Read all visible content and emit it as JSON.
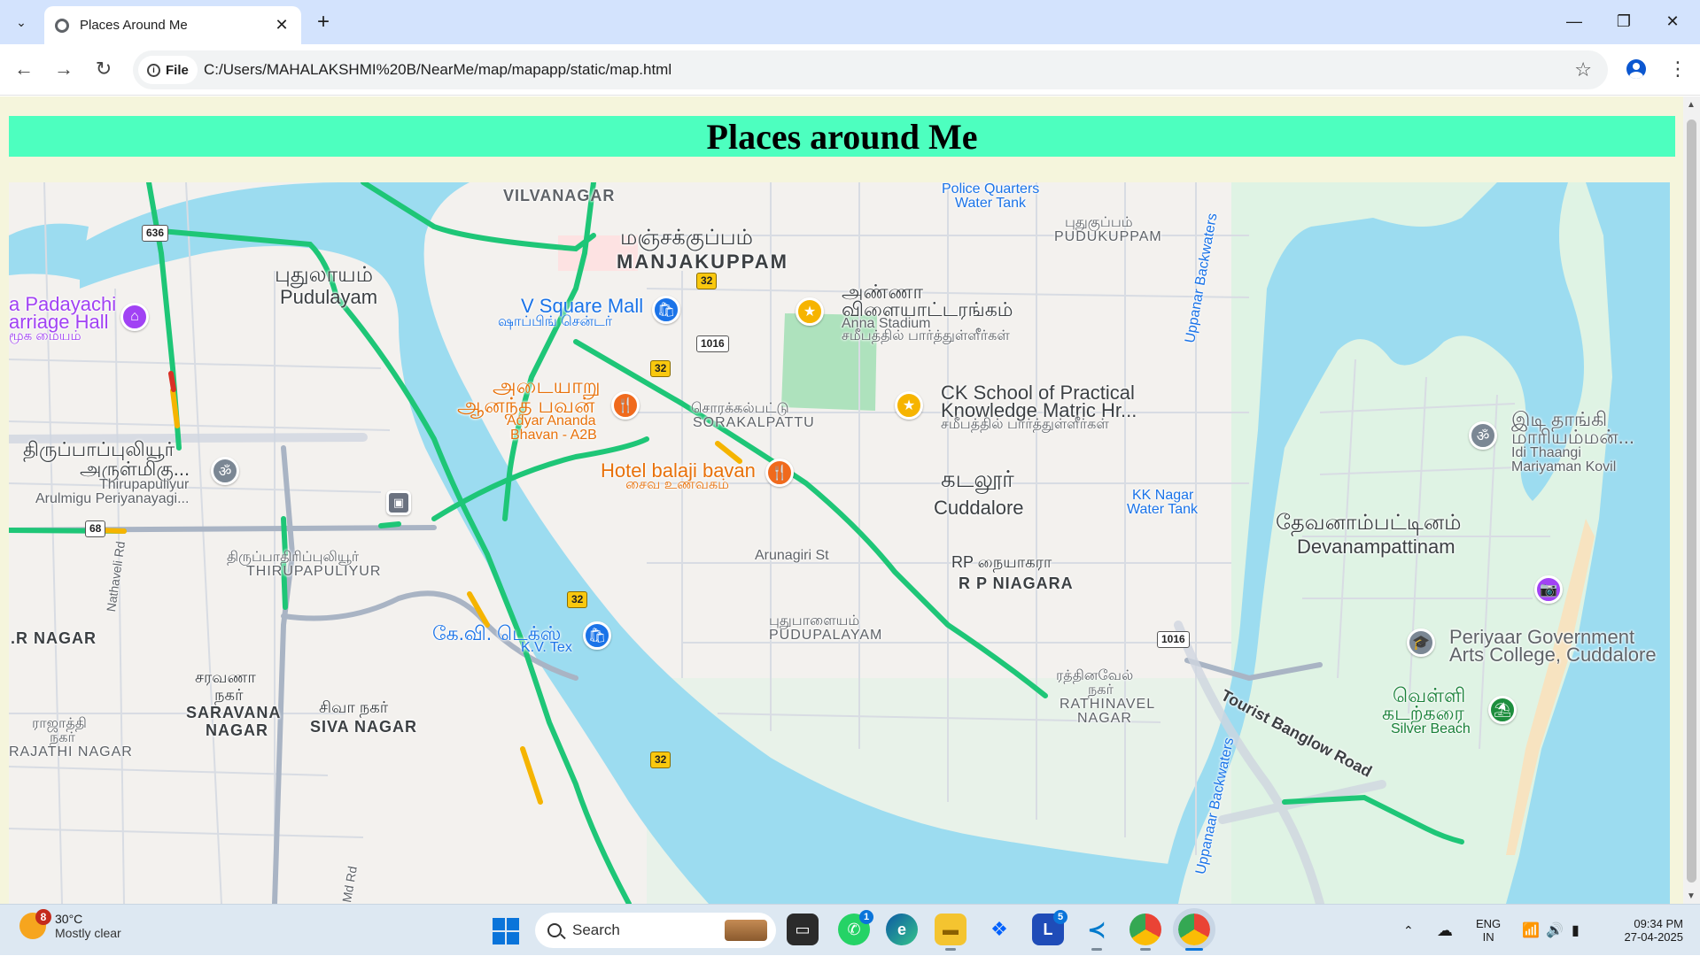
{
  "browser": {
    "tab_title": "Places Around Me",
    "url_chip": "File",
    "url": "C:/Users/MAHALAKSHMI%20B/NearMe/map/mapapp/static/map.html",
    "new_tab": "+",
    "close_tab": "✕",
    "minimize": "—",
    "restore": "❐",
    "close_window": "✕",
    "back": "←",
    "forward": "→",
    "reload": "↻",
    "star": "☆",
    "menu": "⋮",
    "tab_search": "⌄"
  },
  "page": {
    "heading": "Places around Me"
  },
  "map": {
    "colors": {
      "water": "#9cdcf0",
      "traffic_green": "#1ec677",
      "traffic_yellow": "#f5b400",
      "traffic_red": "#d93025",
      "park": "#c9efd5"
    },
    "places": {
      "vilvanagar": "VILVANAGAR",
      "manjakuppam_ta": "மஞ்சக்குப்பம்",
      "manjakuppam": "MANJAKUPPAM",
      "police_tank_1": "Police Quarters",
      "police_tank_2": "Water Tank",
      "pudukuppam_ta": "புதுகுப்பம்",
      "pudukuppam": "PUDUKUPPAM",
      "pudulayam_ta": "புதுலாயம்",
      "pudulayam": "Pudulayam",
      "hall_1": "a Padayachi",
      "hall_2": "arriage Hall",
      "hall_3": "மூக மையம்",
      "vsquare": "V Square Mall",
      "vsquare_ta": "ஷாப்பிங் சென்டர்",
      "stadium_ta_1": "அண்ணா",
      "stadium_ta_2": "விளையாட்டரங்கம்",
      "stadium": "Anna Stadium",
      "stadium_sub": "சமீபத்தில் பார்த்துள்ளீர்கள்",
      "adyar_ta_1": "அடையாறு",
      "adyar_ta_2": "ஆனந்த பவன்",
      "adyar_1": "Adyar Ananda",
      "adyar_2": "Bhavan - A2B",
      "sorakal_ta": "சொரக்கல்பட்டு",
      "sorakal": "SORAKALPATTU",
      "ck_1": "CK School of Practical",
      "ck_2": "Knowledge Matric Hr...",
      "ck_sub": "சமீபத்தில் பார்த்துள்ளீர்கள்",
      "balaji": "Hotel balaji bavan",
      "balaji_ta": "சைவ உணவகம்",
      "thiru_temple_ta_1": "திருப்பாப்புலியூர்",
      "thiru_temple_ta_2": "அருள்மிகு...",
      "thiru_temple_1": "Thirupapuliyur",
      "thiru_temple_2": "Arulmigu Periyanayagi...",
      "cuddalore_ta": "கடலூர்",
      "cuddalore": "Cuddalore",
      "kk_tank_1": "KK Nagar",
      "kk_tank_2": "Water Tank",
      "idi_ta_1": "இடி தாங்கி",
      "idi_ta_2": "மாரியம்மன்...",
      "idi_1": "Idi Thaangi",
      "idi_2": "Mariyaman Kovil",
      "devanam_ta": "தேவனாம்பட்டினம்",
      "devanam": "Devanampattinam",
      "backwaters_1": "Uppanar Backwaters",
      "backwaters_2": "Uppanaar Backwaters",
      "arunagiri": "Arunagiri St",
      "thirupa_ta": "திருப்பாதிரிப்புலியூர்",
      "thirupa": "THIRUPAPULIYUR",
      "rp_ta": "RP நையாகரா",
      "rp": "R P NIAGARA",
      "natha": "Nathaveli Rd",
      "pudupalayam_ta": "புதுபாளையம்",
      "pudupalayam": "PUDUPALAYAM",
      "kvtex_ta": "கே.வி. டெக்ஸ்",
      "kvtex": "K.V. Tex",
      "periyar_1": "Periyaar Government",
      "periyar_2": "Arts College, Cuddalore",
      "rnagar": ".R NAGAR",
      "saravana_ta_1": "சரவணா",
      "saravana_ta_2": "நகர்",
      "saravana_1": "SARAVANA",
      "saravana_2": "NAGAR",
      "siva_ta": "சிவா நகர்",
      "siva": "SIVA NAGAR",
      "rathinavel_ta_1": "ரத்தினவேல்",
      "rathinavel_ta_2": "நகர்",
      "rathinavel_1": "RATHINAVEL",
      "rathinavel_2": "NAGAR",
      "silver_ta_1": "வெள்ளி",
      "silver_ta_2": "கடற்கரை",
      "silver": "Silver Beach",
      "rajathi_ta_1": "ராஜாத்தி",
      "rajathi_ta_2": "நகர்",
      "rajathi": "RAJATHI NAGAR",
      "tourist": "Tourist Banglow Road",
      "md_rd": "Md Rd"
    },
    "road_shields": {
      "r636": "636",
      "r32a": "32",
      "r32b": "32",
      "r32c": "32",
      "r32d": "32",
      "r1016a": "1016",
      "r1016b": "1016",
      "r68": "68"
    }
  },
  "taskbar": {
    "weather_temp": "30°C",
    "weather_desc": "Mostly clear",
    "weather_badge": "8",
    "search_label": "Search",
    "whatsapp_badge": "1",
    "lens_badge": "5",
    "lang_1": "ENG",
    "lang_2": "IN",
    "time": "09:34 PM",
    "date": "27-04-2025"
  }
}
